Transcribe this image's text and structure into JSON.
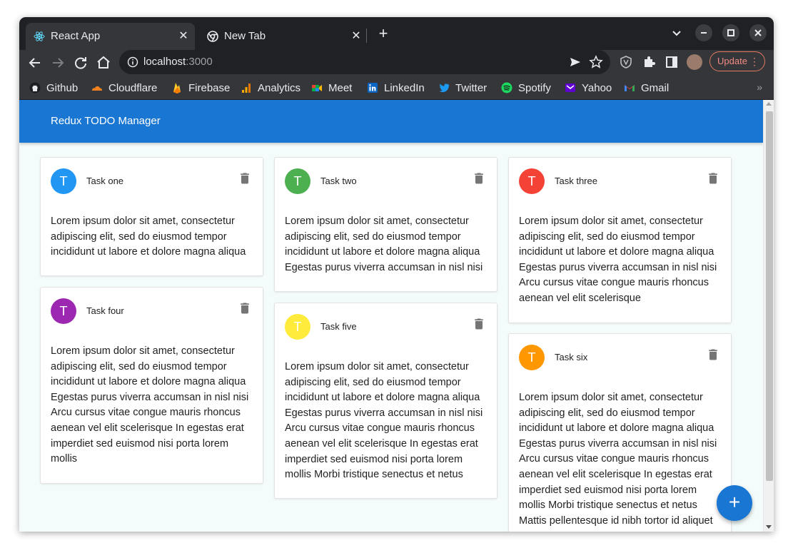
{
  "browser": {
    "tabs": [
      {
        "title": "React App",
        "icon": "react-icon"
      },
      {
        "title": "New Tab",
        "icon": "chrome-icon"
      }
    ],
    "tab_close_label": "✕",
    "new_tab_label": "+",
    "address": {
      "host": "localhost",
      "port": ":3000"
    },
    "update_label": "Update",
    "menu_label": "⋮",
    "bookmarks": [
      {
        "label": "Github",
        "icon": "github-icon",
        "color": "#ffffff"
      },
      {
        "label": "Cloudflare",
        "icon": "cloudflare-icon",
        "color": "#f48120"
      },
      {
        "label": "Firebase",
        "icon": "firebase-icon",
        "color": "#ffca28"
      },
      {
        "label": "Analytics",
        "icon": "analytics-icon",
        "color": "#f9ab00"
      },
      {
        "label": "Meet",
        "icon": "meet-icon",
        "color": "#00ac47"
      },
      {
        "label": "LinkedIn",
        "icon": "linkedin-icon",
        "color": "#0a66c2"
      },
      {
        "label": "Twitter",
        "icon": "twitter-icon",
        "color": "#1d9bf0"
      },
      {
        "label": "Spotify",
        "icon": "spotify-icon",
        "color": "#1ed760"
      },
      {
        "label": "Yahoo",
        "icon": "yahoo-icon",
        "color": "#6001d2"
      },
      {
        "label": "Gmail",
        "icon": "gmail-icon",
        "color": "#ea4335"
      }
    ],
    "bookmarks_more": "»"
  },
  "app": {
    "title": "Redux TODO Manager",
    "fab_label": "+",
    "accent": "#1976d2",
    "tasks": [
      {
        "avatar": "T",
        "title": "Task one",
        "color": "#2196f3",
        "text": "Lorem ipsum dolor sit amet, consectetur adipiscing elit, sed do eiusmod tempor incididunt ut labore et dolore magna aliqua"
      },
      {
        "avatar": "T",
        "title": "Task two",
        "color": "#4caf50",
        "text": "Lorem ipsum dolor sit amet, consectetur adipiscing elit, sed do eiusmod tempor incididunt ut labore et dolore magna aliqua Egestas purus viverra accumsan in nisl nisi"
      },
      {
        "avatar": "T",
        "title": "Task three",
        "color": "#f44336",
        "text": "Lorem ipsum dolor sit amet, consectetur adipiscing elit, sed do eiusmod tempor incididunt ut labore et dolore magna aliqua Egestas purus viverra accumsan in nisl nisi Arcu cursus vitae congue mauris rhoncus aenean vel elit scelerisque"
      },
      {
        "avatar": "T",
        "title": "Task four",
        "color": "#9c27b0",
        "text": "Lorem ipsum dolor sit amet, consectetur adipiscing elit, sed do eiusmod tempor incididunt ut labore et dolore magna aliqua Egestas purus viverra accumsan in nisl nisi Arcu cursus vitae congue mauris rhoncus aenean vel elit scelerisque In egestas erat imperdiet sed euismod nisi porta lorem mollis"
      },
      {
        "avatar": "T",
        "title": "Task five",
        "color": "#ffeb3b",
        "text": "Lorem ipsum dolor sit amet, consectetur adipiscing elit, sed do eiusmod tempor incididunt ut labore et dolore magna aliqua Egestas purus viverra accumsan in nisl nisi Arcu cursus vitae congue mauris rhoncus aenean vel elit scelerisque In egestas erat imperdiet sed euismod nisi porta lorem mollis Morbi tristique senectus et netus"
      },
      {
        "avatar": "T",
        "title": "Task six",
        "color": "#ff9800",
        "text": "Lorem ipsum dolor sit amet, consectetur adipiscing elit, sed do eiusmod tempor incididunt ut labore et dolore magna aliqua Egestas purus viverra accumsan in nisl nisi Arcu cursus vitae congue mauris rhoncus aenean vel elit scelerisque In egestas erat imperdiet sed euismod nisi porta lorem mollis Morbi tristique senectus et netus Mattis pellentesque id nibh tortor id aliquet"
      }
    ]
  }
}
